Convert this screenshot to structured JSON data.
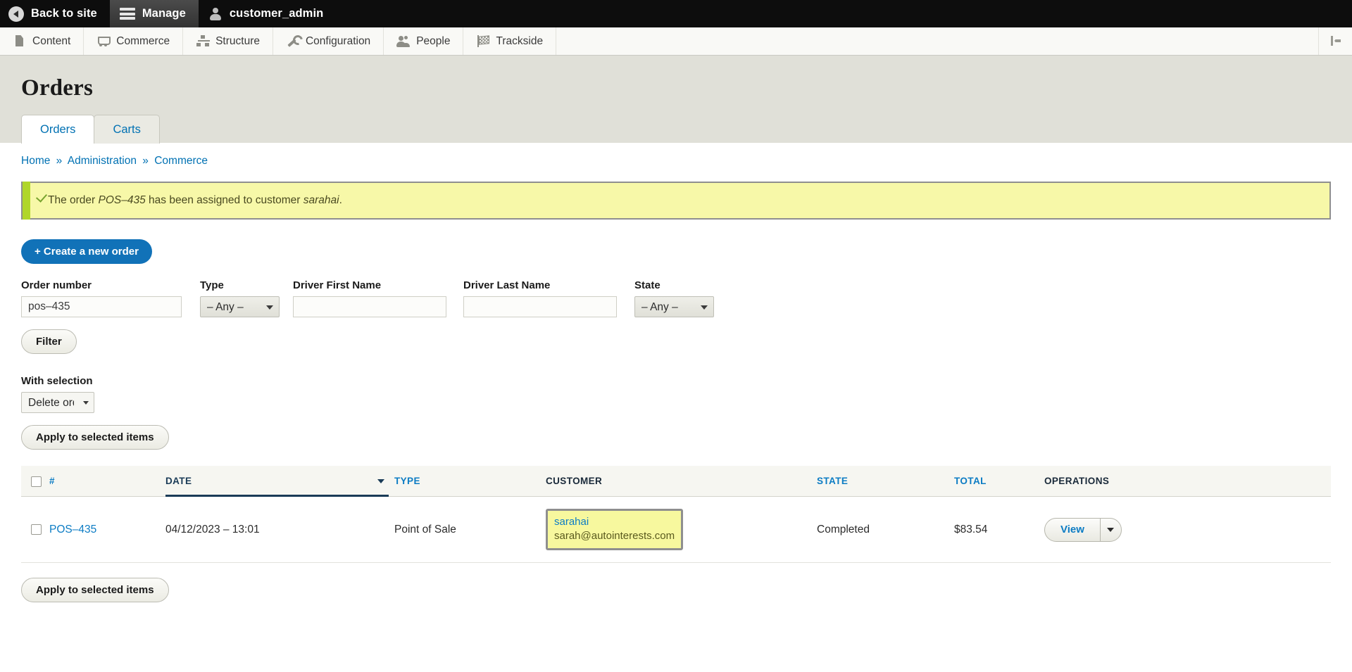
{
  "toolbar": {
    "back_to_site": "Back to site",
    "manage": "Manage",
    "user": "customer_admin",
    "back_icon": "back-arrow-icon",
    "manage_icon": "hamburger-icon",
    "user_icon": "person-icon",
    "orientation_toggle_icon": "toolbar-orientation-toggle-icon"
  },
  "tray": {
    "items": [
      {
        "label": "Content",
        "icon": "document-icon"
      },
      {
        "label": "Commerce",
        "icon": "shopping-cart-icon"
      },
      {
        "label": "Structure",
        "icon": "structure-tree-icon"
      },
      {
        "label": "Configuration",
        "icon": "wrench-icon"
      },
      {
        "label": "People",
        "icon": "people-icon"
      },
      {
        "label": "Trackside",
        "icon": "checkered-flag-icon"
      }
    ]
  },
  "page": {
    "title": "Orders",
    "tabs": [
      {
        "label": "Orders",
        "active": true
      },
      {
        "label": "Carts",
        "active": false
      }
    ],
    "breadcrumb": [
      "Home",
      "Administration",
      "Commerce"
    ],
    "breadcrumb_separator": "»"
  },
  "message": {
    "icon": "check-icon",
    "prefix": "The order ",
    "order_id": "POS–435",
    "middle": " has been assigned to customer ",
    "customer": "sarahai",
    "suffix": "."
  },
  "actions": {
    "create_order": "+ Create a new order"
  },
  "filters": {
    "order_number": {
      "label": "Order number",
      "value": "pos–435"
    },
    "type": {
      "label": "Type",
      "value": "– Any –",
      "options": [
        "– Any –"
      ]
    },
    "driver_first": {
      "label": "Driver First Name",
      "value": ""
    },
    "driver_last": {
      "label": "Driver Last Name",
      "value": ""
    },
    "state": {
      "label": "State",
      "value": "– Any –",
      "options": [
        "– Any –"
      ]
    },
    "filter_button": "Filter"
  },
  "bulk": {
    "label": "With selection",
    "action_value": "Delete order",
    "action_options": [
      "Delete order"
    ],
    "apply_button": "Apply to selected items",
    "apply_button_bottom": "Apply to selected items"
  },
  "table": {
    "columns": [
      {
        "key": "select",
        "label": "",
        "sortable": false,
        "sorted": false
      },
      {
        "key": "number",
        "label": "#",
        "sortable": true,
        "sorted": false
      },
      {
        "key": "date",
        "label": "DATE",
        "sortable": true,
        "sorted": true,
        "direction": "desc"
      },
      {
        "key": "type",
        "label": "TYPE",
        "sortable": true,
        "sorted": false
      },
      {
        "key": "customer",
        "label": "CUSTOMER",
        "sortable": false,
        "sorted": false
      },
      {
        "key": "state",
        "label": "STATE",
        "sortable": true,
        "sorted": false
      },
      {
        "key": "total",
        "label": "TOTAL",
        "sortable": true,
        "sorted": false
      },
      {
        "key": "operations",
        "label": "OPERATIONS",
        "sortable": false,
        "sorted": false
      }
    ],
    "rows": [
      {
        "number": "POS–435",
        "date": "04/12/2023 – 13:01",
        "type": "Point of Sale",
        "customer_name": "sarahai",
        "customer_email": "sarah@autointerests.com",
        "customer_highlighted": true,
        "state": "Completed",
        "total": "$83.54",
        "operation_primary": "View"
      }
    ]
  },
  "colors": {
    "link": "#0c7cc4",
    "primary_button": "#1172b8",
    "message_bg": "#f7f8a8",
    "message_accent": "#b0d62a",
    "highlight_bg": "#f7f89e",
    "toolbar_bg": "#0d0d0d",
    "page_head_bg": "#e0e0d8"
  }
}
